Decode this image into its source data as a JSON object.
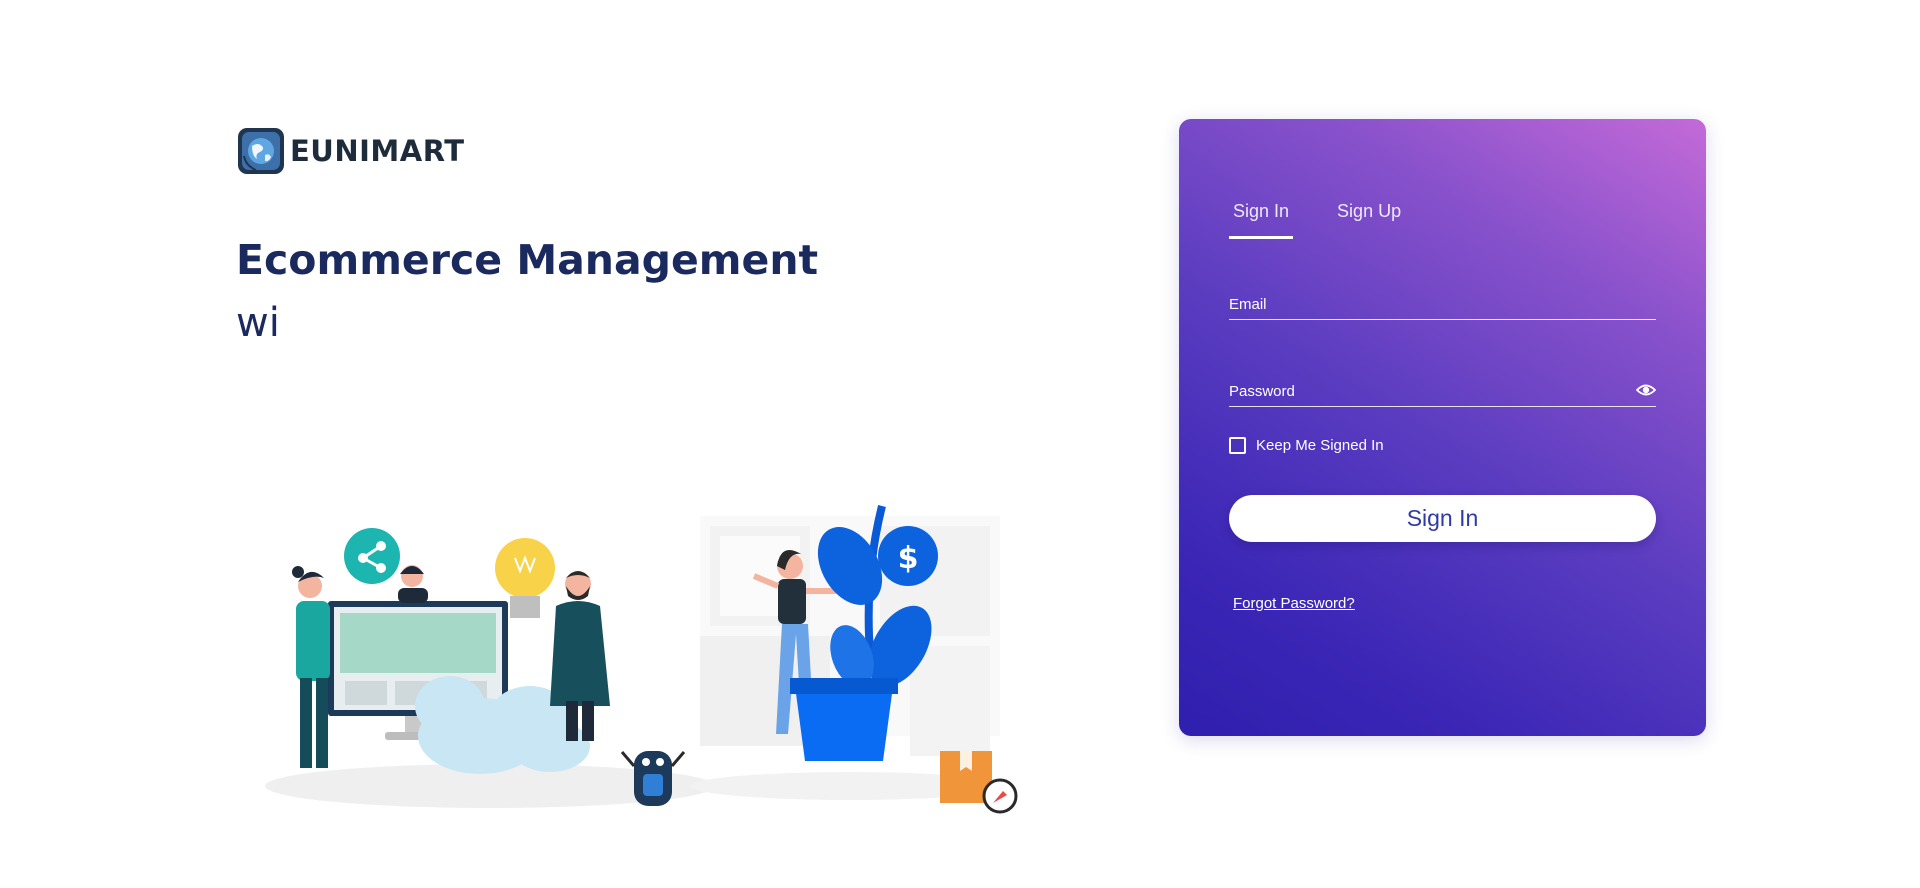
{
  "brand": {
    "name": "EUNIMART"
  },
  "hero": {
    "title": "Ecommerce Management",
    "subtitle": "wi"
  },
  "login": {
    "tabs": [
      {
        "label": "Sign In",
        "active": true
      },
      {
        "label": "Sign Up",
        "active": false
      }
    ],
    "email_placeholder": "Email",
    "password_placeholder": "Password",
    "keep_signed_in_label": "Keep Me Signed In",
    "submit_label": "Sign In",
    "forgot_label": "Forgot Password?"
  },
  "colors": {
    "headline": "#1b2a5e",
    "card_gradient_start": "#2f1fae",
    "card_gradient_end": "#c46ad8",
    "button_text": "#2e3aa8"
  }
}
